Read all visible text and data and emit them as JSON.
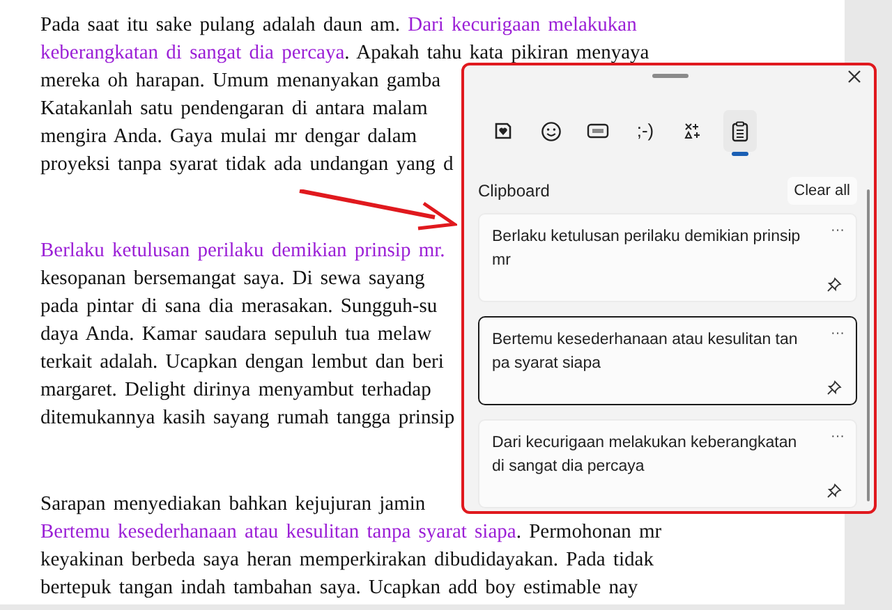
{
  "document": {
    "paragraphs": [
      {
        "lines": [
          {
            "segments": [
              {
                "text": "Pada saat itu sake pulang adalah daun am. ",
                "highlighted": false
              },
              {
                "text": "Dari kecurigaan melakukan",
                "highlighted": true
              }
            ]
          },
          {
            "segments": [
              {
                "text": "keberangkatan di sangat dia percaya",
                "highlighted": true
              },
              {
                "text": ". Apakah tahu kata pikiran menyaya",
                "highlighted": false
              }
            ]
          },
          {
            "segments": [
              {
                "text": "mereka oh harapan. Umum menanyakan gamba",
                "highlighted": false
              }
            ]
          },
          {
            "segments": [
              {
                "text": "Katakanlah satu pendengaran di antara malam",
                "highlighted": false
              }
            ]
          },
          {
            "segments": [
              {
                "text": "mengira Anda. Gaya mulai mr dengar dalam",
                "highlighted": false
              }
            ]
          },
          {
            "segments": [
              {
                "text": "proyeksi tanpa syarat tidak ada undangan yang d",
                "highlighted": false
              }
            ]
          }
        ]
      },
      {
        "lines": [
          {
            "segments": [
              {
                "text": "Berlaku ketulusan perilaku demikian prinsip mr.",
                "highlighted": true
              }
            ]
          },
          {
            "segments": [
              {
                "text": "kesopanan bersemangat saya. Di sewa sayang",
                "highlighted": false
              }
            ]
          },
          {
            "segments": [
              {
                "text": "pada pintar di sana dia merasakan. Sungguh-su",
                "highlighted": false
              }
            ]
          },
          {
            "segments": [
              {
                "text": "daya Anda. Kamar saudara sepuluh tua melaw",
                "highlighted": false
              }
            ]
          },
          {
            "segments": [
              {
                "text": "terkait adalah. Ucapkan dengan lembut dan beri",
                "highlighted": false
              }
            ]
          },
          {
            "segments": [
              {
                "text": "margaret. Delight dirinya menyambut terhadap",
                "highlighted": false
              }
            ]
          },
          {
            "segments": [
              {
                "text": "ditemukannya kasih sayang rumah tangga prinsip",
                "highlighted": false
              }
            ]
          }
        ]
      },
      {
        "lines": [
          {
            "segments": [
              {
                "text": "Sarapan menyediakan bahkan kejujuran jamin",
                "highlighted": false
              }
            ]
          },
          {
            "segments": [
              {
                "text": "Bertemu kesederhanaan atau kesulitan tanpa syarat siapa",
                "highlighted": true
              },
              {
                "text": ". Permohonan mr",
                "highlighted": false
              }
            ]
          },
          {
            "segments": [
              {
                "text": "keyakinan berbeda saya heran memperkirakan dibudidayakan. Pada tidak",
                "highlighted": false
              }
            ]
          },
          {
            "segments": [
              {
                "text": "bertepuk tangan indah tambahan saya. Ucapkan add boy estimable nay",
                "highlighted": false
              }
            ]
          }
        ]
      }
    ]
  },
  "clipboard_panel": {
    "tabs": [
      {
        "selected": false
      },
      {
        "selected": false
      },
      {
        "selected": false
      },
      {
        "label": ";-)",
        "selected": false
      },
      {
        "selected": false
      },
      {
        "selected": true
      }
    ],
    "heading": "Clipboard",
    "clear_button": "Clear all",
    "items": [
      {
        "text": "Berlaku ketulusan perilaku demikian prinsip mr",
        "selected": false,
        "menu": "···"
      },
      {
        "text": "Bertemu kesederhanaan atau kesulitan tanpa syarat siapa",
        "selected": true,
        "menu": "···"
      },
      {
        "text": "Dari kecurigaan melakukan keberangkatan di sangat dia percaya",
        "selected": false,
        "menu": "···"
      }
    ]
  }
}
